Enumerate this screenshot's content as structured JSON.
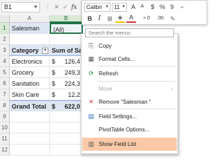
{
  "formula_bar": {
    "name_box": "B1",
    "fx_label": "fx",
    "cancel_symbol": "✕",
    "enter_symbol": "✓",
    "dots": "⋮"
  },
  "columns": [
    "A",
    "B"
  ],
  "rows": [
    "1",
    "2",
    "3",
    "4",
    "5",
    "6",
    "7",
    "8",
    "9",
    "10",
    "11",
    "12"
  ],
  "cells": {
    "a1": "Salesman",
    "b1": "(All)",
    "a3": "Category",
    "b3": "Sum of Sa",
    "a4": "Electronics",
    "b4_cur": "$",
    "b4_val": "126,4",
    "a5": "Grocery",
    "b5_cur": "$",
    "b5_val": "249,3",
    "a6": "Sanitation",
    "b6_cur": "$",
    "b6_val": "224,3",
    "a7": "Skin Care",
    "b7_cur": "$",
    "b7_val": "12,2",
    "a8": "Grand Total",
    "b8_cur": "$",
    "b8_val": "622,0"
  },
  "mini_toolbar": {
    "font": "Calibri",
    "size": "11",
    "buttons": [
      "A",
      "A",
      "$",
      "%",
      "9",
      "B",
      "I",
      "A",
      "+.0",
      ".00"
    ]
  },
  "context_menu": {
    "search_placeholder": "Search the menus",
    "items": [
      {
        "label": "Copy",
        "icon": "copy-icon",
        "glyph": "⎘"
      },
      {
        "label": "Format Cells...",
        "icon": "format-cells-icon",
        "glyph": "▦"
      },
      {
        "label": "Refresh",
        "icon": "refresh-icon",
        "glyph": "⟳"
      },
      {
        "label": "Move",
        "icon": "",
        "glyph": "",
        "submenu": "›"
      },
      {
        "label": "Remove \"Salesman \"",
        "icon": "remove-icon",
        "glyph": "✕"
      },
      {
        "label": "Field Settings...",
        "icon": "field-settings-icon",
        "glyph": "▤"
      },
      {
        "label": "PivotTable Options...",
        "icon": "",
        "glyph": ""
      },
      {
        "label": "Show Field List",
        "icon": "field-list-icon",
        "glyph": "▥"
      }
    ]
  },
  "colors": {
    "highlight": "#f9c9a8",
    "band": "#dde6f2",
    "selection": "#217346",
    "remove_icon": "#d13438"
  }
}
